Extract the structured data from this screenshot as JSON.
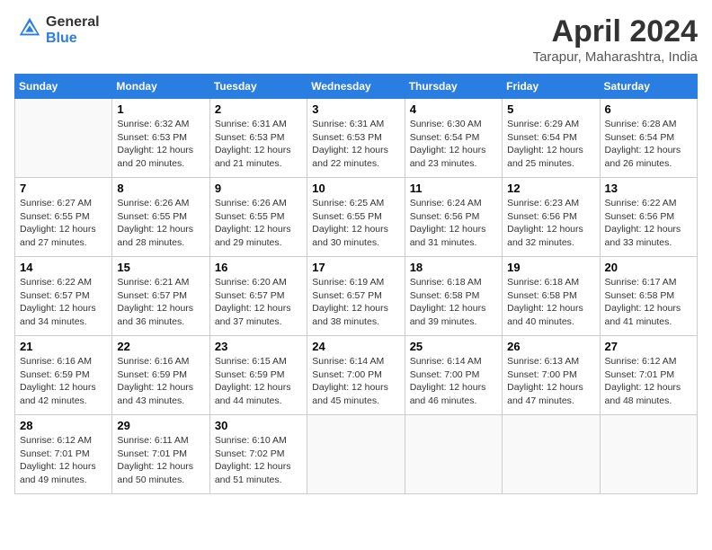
{
  "header": {
    "logo_line1": "General",
    "logo_line2": "Blue",
    "title": "April 2024",
    "location": "Tarapur, Maharashtra, India"
  },
  "days_of_week": [
    "Sunday",
    "Monday",
    "Tuesday",
    "Wednesday",
    "Thursday",
    "Friday",
    "Saturday"
  ],
  "weeks": [
    [
      {
        "day": "",
        "info": ""
      },
      {
        "day": "1",
        "info": "Sunrise: 6:32 AM\nSunset: 6:53 PM\nDaylight: 12 hours\nand 20 minutes."
      },
      {
        "day": "2",
        "info": "Sunrise: 6:31 AM\nSunset: 6:53 PM\nDaylight: 12 hours\nand 21 minutes."
      },
      {
        "day": "3",
        "info": "Sunrise: 6:31 AM\nSunset: 6:53 PM\nDaylight: 12 hours\nand 22 minutes."
      },
      {
        "day": "4",
        "info": "Sunrise: 6:30 AM\nSunset: 6:54 PM\nDaylight: 12 hours\nand 23 minutes."
      },
      {
        "day": "5",
        "info": "Sunrise: 6:29 AM\nSunset: 6:54 PM\nDaylight: 12 hours\nand 25 minutes."
      },
      {
        "day": "6",
        "info": "Sunrise: 6:28 AM\nSunset: 6:54 PM\nDaylight: 12 hours\nand 26 minutes."
      }
    ],
    [
      {
        "day": "7",
        "info": "Sunrise: 6:27 AM\nSunset: 6:55 PM\nDaylight: 12 hours\nand 27 minutes."
      },
      {
        "day": "8",
        "info": "Sunrise: 6:26 AM\nSunset: 6:55 PM\nDaylight: 12 hours\nand 28 minutes."
      },
      {
        "day": "9",
        "info": "Sunrise: 6:26 AM\nSunset: 6:55 PM\nDaylight: 12 hours\nand 29 minutes."
      },
      {
        "day": "10",
        "info": "Sunrise: 6:25 AM\nSunset: 6:55 PM\nDaylight: 12 hours\nand 30 minutes."
      },
      {
        "day": "11",
        "info": "Sunrise: 6:24 AM\nSunset: 6:56 PM\nDaylight: 12 hours\nand 31 minutes."
      },
      {
        "day": "12",
        "info": "Sunrise: 6:23 AM\nSunset: 6:56 PM\nDaylight: 12 hours\nand 32 minutes."
      },
      {
        "day": "13",
        "info": "Sunrise: 6:22 AM\nSunset: 6:56 PM\nDaylight: 12 hours\nand 33 minutes."
      }
    ],
    [
      {
        "day": "14",
        "info": "Sunrise: 6:22 AM\nSunset: 6:57 PM\nDaylight: 12 hours\nand 34 minutes."
      },
      {
        "day": "15",
        "info": "Sunrise: 6:21 AM\nSunset: 6:57 PM\nDaylight: 12 hours\nand 36 minutes."
      },
      {
        "day": "16",
        "info": "Sunrise: 6:20 AM\nSunset: 6:57 PM\nDaylight: 12 hours\nand 37 minutes."
      },
      {
        "day": "17",
        "info": "Sunrise: 6:19 AM\nSunset: 6:57 PM\nDaylight: 12 hours\nand 38 minutes."
      },
      {
        "day": "18",
        "info": "Sunrise: 6:18 AM\nSunset: 6:58 PM\nDaylight: 12 hours\nand 39 minutes."
      },
      {
        "day": "19",
        "info": "Sunrise: 6:18 AM\nSunset: 6:58 PM\nDaylight: 12 hours\nand 40 minutes."
      },
      {
        "day": "20",
        "info": "Sunrise: 6:17 AM\nSunset: 6:58 PM\nDaylight: 12 hours\nand 41 minutes."
      }
    ],
    [
      {
        "day": "21",
        "info": "Sunrise: 6:16 AM\nSunset: 6:59 PM\nDaylight: 12 hours\nand 42 minutes."
      },
      {
        "day": "22",
        "info": "Sunrise: 6:16 AM\nSunset: 6:59 PM\nDaylight: 12 hours\nand 43 minutes."
      },
      {
        "day": "23",
        "info": "Sunrise: 6:15 AM\nSunset: 6:59 PM\nDaylight: 12 hours\nand 44 minutes."
      },
      {
        "day": "24",
        "info": "Sunrise: 6:14 AM\nSunset: 7:00 PM\nDaylight: 12 hours\nand 45 minutes."
      },
      {
        "day": "25",
        "info": "Sunrise: 6:14 AM\nSunset: 7:00 PM\nDaylight: 12 hours\nand 46 minutes."
      },
      {
        "day": "26",
        "info": "Sunrise: 6:13 AM\nSunset: 7:00 PM\nDaylight: 12 hours\nand 47 minutes."
      },
      {
        "day": "27",
        "info": "Sunrise: 6:12 AM\nSunset: 7:01 PM\nDaylight: 12 hours\nand 48 minutes."
      }
    ],
    [
      {
        "day": "28",
        "info": "Sunrise: 6:12 AM\nSunset: 7:01 PM\nDaylight: 12 hours\nand 49 minutes."
      },
      {
        "day": "29",
        "info": "Sunrise: 6:11 AM\nSunset: 7:01 PM\nDaylight: 12 hours\nand 50 minutes."
      },
      {
        "day": "30",
        "info": "Sunrise: 6:10 AM\nSunset: 7:02 PM\nDaylight: 12 hours\nand 51 minutes."
      },
      {
        "day": "",
        "info": ""
      },
      {
        "day": "",
        "info": ""
      },
      {
        "day": "",
        "info": ""
      },
      {
        "day": "",
        "info": ""
      }
    ]
  ]
}
